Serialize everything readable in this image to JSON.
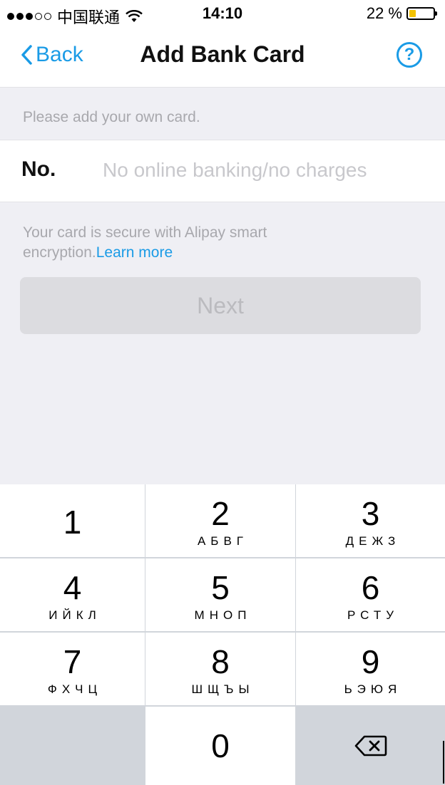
{
  "status_bar": {
    "carrier": "中国联通",
    "time": "14:10",
    "battery": "22 %",
    "battery_level": 0.22
  },
  "nav": {
    "back_label": "Back",
    "title": "Add Bank Card",
    "help_symbol": "?"
  },
  "form": {
    "hint": "Please add your own card.",
    "card_label": "No.",
    "card_placeholder": "No online banking/no charges",
    "card_value": "",
    "secure_text": "Your card is secure with Alipay smart encryption.",
    "learn_more": "Learn more",
    "next_label": "Next"
  },
  "keypad": {
    "keys": [
      {
        "num": "1",
        "letters": ""
      },
      {
        "num": "2",
        "letters": "АБВГ"
      },
      {
        "num": "3",
        "letters": "ДЕЖЗ"
      },
      {
        "num": "4",
        "letters": "ИЙКЛ"
      },
      {
        "num": "5",
        "letters": "МНОП"
      },
      {
        "num": "6",
        "letters": "РСТУ"
      },
      {
        "num": "7",
        "letters": "ФХЧЦ"
      },
      {
        "num": "8",
        "letters": "ШЩЪЫ"
      },
      {
        "num": "9",
        "letters": "ЬЭЮЯ"
      }
    ],
    "zero": "0",
    "delete_icon": "backspace-icon"
  },
  "colors": {
    "accent": "#1a9be6",
    "background": "#efeff4",
    "button_disabled": "#dcdce0",
    "battery_fill": "#f2c200"
  }
}
